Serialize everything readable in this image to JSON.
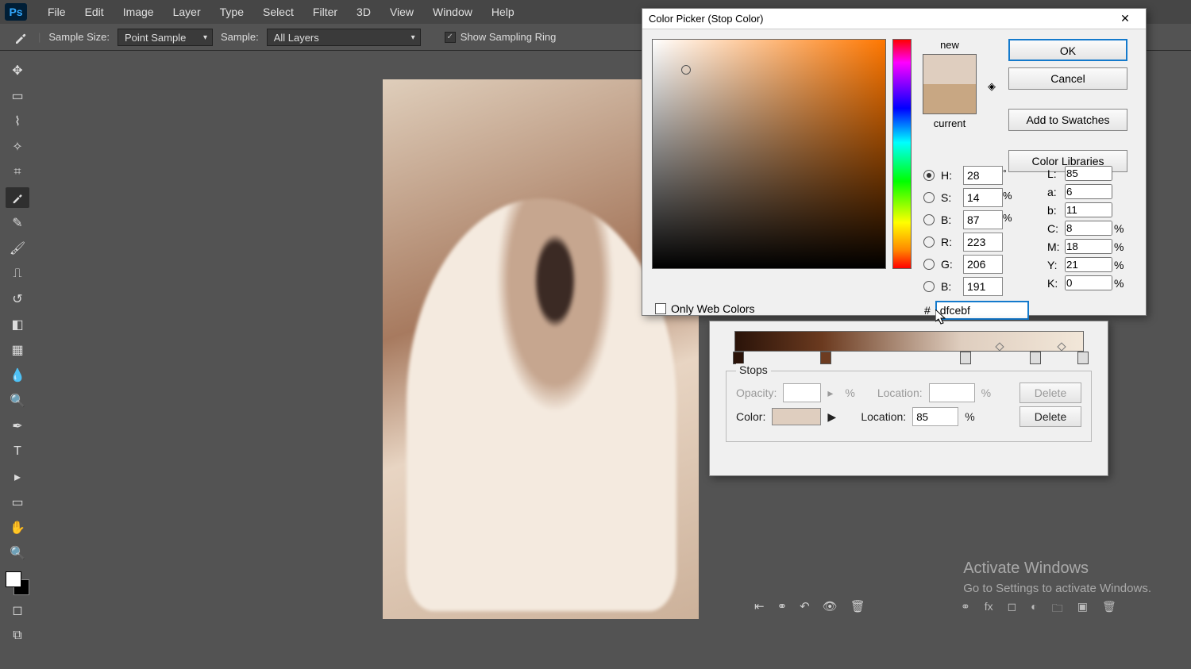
{
  "menubar": {
    "items": [
      "File",
      "Edit",
      "Image",
      "Layer",
      "Type",
      "Select",
      "Filter",
      "3D",
      "View",
      "Window",
      "Help"
    ]
  },
  "logo": "Ps",
  "options": {
    "sample_size_label": "Sample Size:",
    "sample_size_value": "Point Sample",
    "sample_label": "Sample:",
    "sample_value": "All Layers",
    "show_ring": "Show Sampling Ring"
  },
  "tools": [
    "move",
    "marquee",
    "lasso",
    "wand",
    "crop",
    "eyedropper",
    "spot",
    "brush",
    "stamp",
    "history",
    "eraser",
    "gradient",
    "blur",
    "dodge",
    "pen",
    "type",
    "path",
    "rect",
    "hand",
    "zoom"
  ],
  "picker": {
    "title": "Color Picker (Stop Color)",
    "new_label": "new",
    "current_label": "current",
    "ok": "OK",
    "cancel": "Cancel",
    "add": "Add to Swatches",
    "libs": "Color Libraries",
    "webonly": "Only Web Colors",
    "hex_label": "#",
    "hex": "dfcebf",
    "fields": {
      "H": "28",
      "S": "14",
      "B": "87",
      "R": "223",
      "G": "206",
      "Bb": "191",
      "L": "85",
      "a": "6",
      "b": "11",
      "C": "8",
      "M": "18",
      "Y": "21",
      "K": "0"
    }
  },
  "grad": {
    "stops_label": "Stops",
    "opacity_label": "Opacity:",
    "location_label": "Location:",
    "color_label": "Color:",
    "location_value": "85",
    "delete": "Delete",
    "pct": "%"
  },
  "watermark": {
    "t1": "Activate Windows",
    "t2": "Go to Settings to activate Windows."
  }
}
